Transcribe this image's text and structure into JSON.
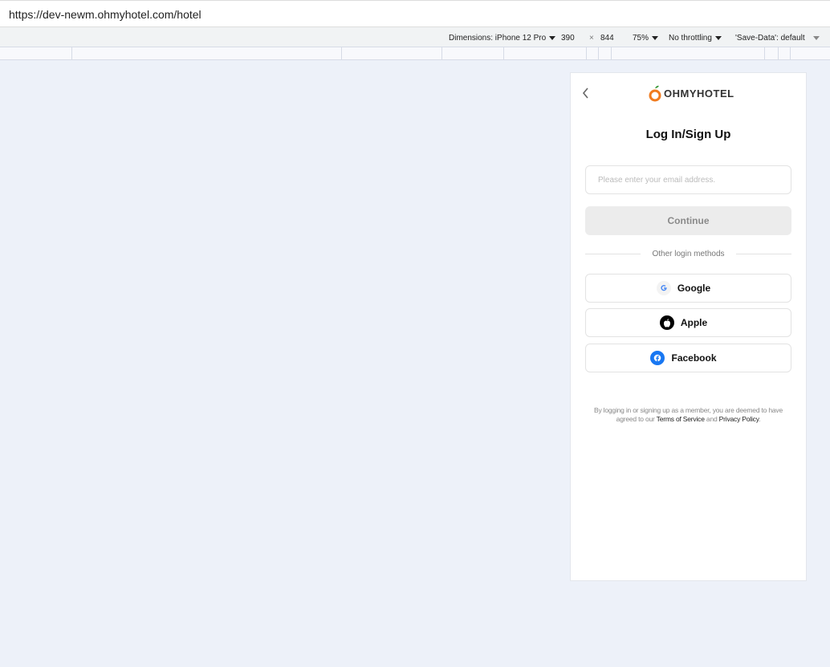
{
  "browser": {
    "url": "https://dev-newm.ohmyhotel.com/hotel"
  },
  "devtools": {
    "dimensions": "Dimensions: iPhone 12 Pro",
    "width": "390",
    "times": "×",
    "height": "844",
    "zoom": "75%",
    "throttling": "No throttling",
    "save_data": "'Save-Data': default"
  },
  "app": {
    "logo": "OHMYHOTEL",
    "title": "Log In/Sign Up",
    "email_placeholder": "Please enter your email address.",
    "continue": "Continue",
    "divider": "Other login methods",
    "social": [
      {
        "label": "Google",
        "icon": "google-icon"
      },
      {
        "label": "Apple",
        "icon": "apple-icon"
      },
      {
        "label": "Facebook",
        "icon": "facebook-icon",
        "color": "#1877f2"
      }
    ],
    "terms_prefix": "By logging in or signing up as a member, you are deemed to have agreed to our ",
    "terms_link": "Terms of Service",
    "terms_and": " and ",
    "privacy_link": "Privacy Policy",
    "terms_suffix": "."
  }
}
